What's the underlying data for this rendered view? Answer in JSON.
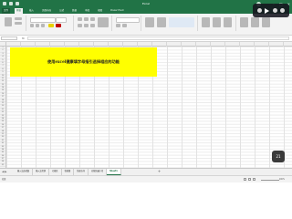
{
  "window": {
    "title": "Excel"
  },
  "ribbon": {
    "tabs": [
      "文件",
      "开始",
      "插入",
      "页面布局",
      "公式",
      "数据",
      "审阅",
      "视图",
      "Power Pivot"
    ]
  },
  "sheet": {
    "highlight_text": "使用excel健康填字母指引选择相应的功能",
    "row_numbers": [
      "1",
      "2",
      "3",
      "4",
      "5",
      "6",
      "7",
      "8",
      "9",
      "10",
      "11",
      "12",
      "13",
      "14",
      "15",
      "16",
      "17",
      "18",
      "19",
      "20",
      "21",
      "22",
      "23",
      "24",
      "25",
      "26",
      "27",
      "28",
      "29",
      "30",
      "31",
      "32",
      "33",
      "34",
      "35",
      "36",
      "37",
      "38",
      "39"
    ]
  },
  "sheet_tabs": {
    "items": [
      "输入法选择窗",
      "输入法切换",
      "功能区",
      "快捷键",
      "快速访问",
      "功能区最小化",
      "Sheet1"
    ],
    "active_index": 6,
    "add_label": "+"
  },
  "status": {
    "ready": "就绪",
    "zoom": "100%"
  },
  "overlay": {
    "counter": "21"
  },
  "colors": {
    "excel_green": "#217346",
    "highlight_yellow": "#ffff00"
  }
}
